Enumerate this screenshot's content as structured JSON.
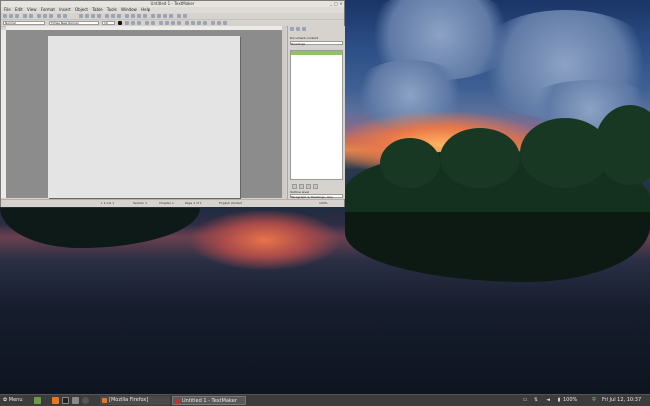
{
  "window": {
    "title": "Untitled 1 - TextMaker",
    "controls": {
      "minimize": "_",
      "maximize": "□",
      "close": "×"
    }
  },
  "menubar": [
    "File",
    "Edit",
    "View",
    "Format",
    "Insert",
    "Object",
    "Table",
    "Tools",
    "Window",
    "Help"
  ],
  "format_toolbar": {
    "style_value": "Normal",
    "font_value": "Times New Roman",
    "size_value": "10"
  },
  "statusbar": {
    "position": "L 1 Col 1",
    "section": "Section 1",
    "chapter": "Chapter 1",
    "page": "Page 1 of 1",
    "language": "English (United"
  },
  "sidepanel": {
    "title": "Document content",
    "filter_value": "Headings",
    "selected_item": "",
    "outline_label": "Outline level",
    "outline_value": "Paragraph & Headings, only",
    "zoom_value": "100%"
  },
  "taskbar": {
    "menu_label": "Menu",
    "tasks": [
      {
        "label": "[Mozilla Firefox]",
        "active": false
      },
      {
        "label": "Untitled 1 - TextMaker",
        "active": true
      }
    ],
    "battery": "100%",
    "clock": "Fri Jul 12, 10:37"
  },
  "colors": {
    "taskbar_bg": "#3c3c3c",
    "sidepanel_selection": "#8fc36b",
    "active_task_bg": "#5a5a5a"
  }
}
